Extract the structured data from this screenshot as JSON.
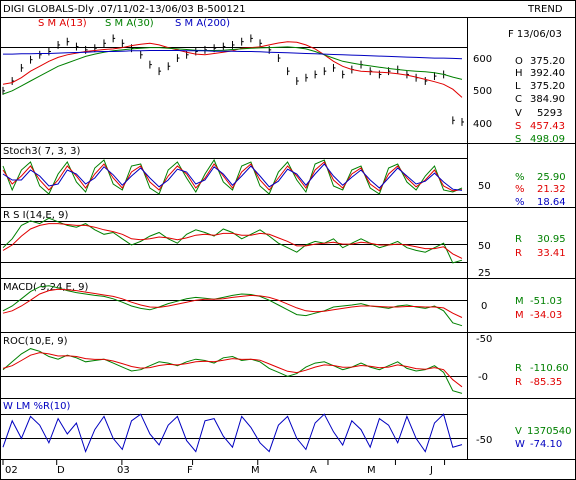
{
  "header": {
    "title": "DIGI GLOBALS-Dly .07/11/02-13/06/03  B-500121",
    "trend": "TREND"
  },
  "colors": {
    "black": "#000000",
    "red": "#e00000",
    "green": "#008000",
    "blue": "#0000c0"
  },
  "chart_data": [
    {
      "type": "line",
      "panel": "price",
      "legend": [
        {
          "label": "S M A(13)",
          "color": "#e00000"
        },
        {
          "label": "S M A(30)",
          "color": "#008000"
        },
        {
          "label": "S M A(200)",
          "color": "#0000c0"
        }
      ],
      "ylim": [
        330,
        690
      ],
      "yticks": [
        "600",
        "500",
        "400"
      ],
      "series": [
        {
          "name": "S M A(13)",
          "values": [
            500,
            505,
            520,
            540,
            555,
            570,
            582,
            590,
            595,
            600,
            603,
            606,
            608,
            612,
            618,
            622,
            625,
            620,
            612,
            605,
            598,
            592,
            590,
            594,
            598,
            602,
            610,
            612,
            614,
            620,
            626,
            630,
            628,
            620,
            608,
            590,
            570,
            555,
            545,
            540,
            538,
            537,
            535,
            532,
            528,
            522,
            515,
            508,
            500,
            485,
            460
          ]
        },
        {
          "name": "S M A(30)",
          "values": [
            470,
            480,
            495,
            510,
            525,
            540,
            555,
            565,
            575,
            585,
            592,
            598,
            602,
            605,
            608,
            610,
            612,
            612,
            610,
            608,
            606,
            604,
            603,
            603,
            604,
            606,
            608,
            610,
            611,
            612,
            613,
            614,
            612,
            608,
            600,
            590,
            580,
            570,
            565,
            560,
            556,
            552,
            548,
            545,
            542,
            540,
            538,
            535,
            530,
            522,
            515
          ]
        },
        {
          "name": "S M A(200)",
          "values": [
            592,
            592,
            593,
            593,
            594,
            594,
            595,
            596,
            597,
            598,
            599,
            600,
            600,
            601,
            602,
            602,
            603,
            603,
            603,
            603,
            602,
            602,
            602,
            601,
            601,
            601,
            600,
            600,
            599,
            598,
            597,
            596,
            595,
            594,
            593,
            592,
            591,
            590,
            589,
            588,
            587,
            586,
            585,
            584,
            583,
            582,
            581,
            580,
            580,
            579,
            578
          ]
        },
        {
          "name": "Close",
          "values": [
            480,
            510,
            550,
            575,
            590,
            600,
            620,
            630,
            615,
            605,
            610,
            625,
            640,
            625,
            610,
            590,
            560,
            540,
            555,
            580,
            590,
            600,
            605,
            610,
            615,
            620,
            630,
            640,
            625,
            605,
            580,
            540,
            510,
            520,
            530,
            540,
            550,
            530,
            545,
            560,
            540,
            530,
            540,
            545,
            530,
            520,
            510,
            525,
            530,
            390,
            385
          ]
        }
      ],
      "readout": {
        "date": "F 13/06/03",
        "rows": [
          {
            "k": "O",
            "v": "375.20",
            "color": "#000000"
          },
          {
            "k": "H",
            "v": "392.40",
            "color": "#000000"
          },
          {
            "k": "L",
            "v": "375.20",
            "color": "#000000"
          },
          {
            "k": "C",
            "v": "384.90",
            "color": "#000000"
          },
          {
            "k": "V",
            "v": "5293",
            "color": "#000000"
          },
          {
            "k": "S",
            "v": "457.43",
            "color": "#e00000"
          },
          {
            "k": "S",
            "v": "498.09",
            "color": "#008000"
          }
        ]
      }
    },
    {
      "type": "line",
      "panel": "stochastic",
      "title": "Stoch3( 7, 3, 3)",
      "yticks": [
        "50"
      ],
      "series": [
        {
          "name": "%K",
          "values": [
            80,
            20,
            70,
            90,
            30,
            10,
            60,
            90,
            40,
            15,
            75,
            95,
            35,
            20,
            80,
            85,
            25,
            10,
            70,
            90,
            50,
            15,
            60,
            95,
            40,
            20,
            80,
            90,
            30,
            10,
            65,
            90,
            45,
            15,
            85,
            95,
            30,
            20,
            70,
            80,
            25,
            10,
            75,
            85,
            40,
            20,
            55,
            80,
            20,
            15,
            25
          ]
        },
        {
          "name": "%D",
          "values": [
            70,
            35,
            55,
            80,
            45,
            20,
            45,
            80,
            55,
            25,
            60,
            85,
            50,
            25,
            65,
            80,
            40,
            20,
            55,
            80,
            60,
            25,
            50,
            85,
            55,
            25,
            65,
            85,
            45,
            20,
            50,
            80,
            55,
            25,
            70,
            90,
            45,
            25,
            60,
            75,
            35,
            18,
            60,
            80,
            50,
            28,
            45,
            70,
            30,
            18,
            21
          ]
        },
        {
          "name": "%D slow",
          "values": [
            60,
            45,
            45,
            70,
            55,
            30,
            35,
            70,
            60,
            35,
            50,
            78,
            58,
            32,
            55,
            75,
            50,
            28,
            45,
            72,
            65,
            35,
            45,
            78,
            60,
            32,
            55,
            80,
            55,
            28,
            42,
            72,
            60,
            32,
            60,
            85,
            55,
            32,
            52,
            70,
            45,
            25,
            50,
            75,
            55,
            35,
            42,
            62,
            40,
            22,
            19
          ]
        }
      ],
      "readout": [
        {
          "k": "%",
          "v": "25.90",
          "color": "#008000"
        },
        {
          "k": "%",
          "v": "21.32",
          "color": "#e00000"
        },
        {
          "k": "%",
          "v": "18.64",
          "color": "#0000c0"
        }
      ]
    },
    {
      "type": "line",
      "panel": "rsi",
      "title": "R S I(14,E, 9)",
      "yticks": [
        "50",
        "25"
      ],
      "series": [
        {
          "name": "RSI",
          "values": [
            45,
            55,
            70,
            75,
            72,
            78,
            74,
            70,
            68,
            72,
            65,
            60,
            62,
            55,
            48,
            52,
            58,
            62,
            55,
            50,
            60,
            65,
            62,
            58,
            66,
            62,
            55,
            60,
            65,
            58,
            50,
            45,
            40,
            48,
            52,
            50,
            55,
            45,
            50,
            55,
            50,
            45,
            48,
            52,
            45,
            42,
            40,
            45,
            50,
            28,
            31
          ]
        },
        {
          "name": "Signal",
          "values": [
            42,
            48,
            58,
            66,
            70,
            72,
            72,
            71,
            70,
            70,
            68,
            65,
            63,
            60,
            55,
            54,
            55,
            57,
            56,
            54,
            56,
            59,
            60,
            59,
            61,
            61,
            59,
            59,
            61,
            60,
            56,
            52,
            47,
            47,
            49,
            50,
            51,
            49,
            49,
            51,
            50,
            48,
            48,
            49,
            48,
            46,
            44,
            44,
            46,
            38,
            33
          ]
        }
      ],
      "readout": [
        {
          "k": "R",
          "v": "30.95",
          "color": "#008000"
        },
        {
          "k": "R",
          "v": "33.41",
          "color": "#e00000"
        }
      ]
    },
    {
      "type": "line",
      "panel": "macd",
      "title": "MACD( 9,24,E, 9)",
      "yticks": [
        "0",
        "-50"
      ],
      "series": [
        {
          "name": "MACD",
          "values": [
            -20,
            -10,
            5,
            20,
            30,
            32,
            28,
            22,
            18,
            15,
            12,
            10,
            5,
            -2,
            -10,
            -15,
            -18,
            -12,
            -5,
            0,
            5,
            8,
            6,
            4,
            8,
            12,
            15,
            14,
            10,
            2,
            -8,
            -18,
            -28,
            -30,
            -25,
            -20,
            -12,
            -10,
            -8,
            -5,
            -10,
            -12,
            -15,
            -10,
            -8,
            -12,
            -15,
            -10,
            -20,
            -45,
            -51
          ]
        },
        {
          "name": "Signal",
          "values": [
            -25,
            -20,
            -10,
            2,
            15,
            22,
            25,
            24,
            22,
            19,
            16,
            13,
            10,
            5,
            -2,
            -8,
            -12,
            -13,
            -10,
            -6,
            -2,
            2,
            4,
            4,
            5,
            8,
            10,
            12,
            11,
            8,
            2,
            -6,
            -14,
            -20,
            -22,
            -21,
            -18,
            -15,
            -12,
            -10,
            -10,
            -11,
            -12,
            -12,
            -11,
            -11,
            -12,
            -12,
            -14,
            -25,
            -34
          ]
        }
      ],
      "readout": [
        {
          "k": "M",
          "v": "-51.03",
          "color": "#008000"
        },
        {
          "k": "M",
          "v": "-34.03",
          "color": "#e00000"
        }
      ]
    },
    {
      "type": "line",
      "panel": "roc",
      "title": "ROC(10,E, 9)",
      "yticks": [
        "-0"
      ],
      "series": [
        {
          "name": "ROC",
          "values": [
            -20,
            10,
            40,
            60,
            50,
            30,
            20,
            35,
            25,
            10,
            15,
            20,
            5,
            -10,
            -25,
            -20,
            -5,
            10,
            5,
            -5,
            10,
            20,
            15,
            5,
            25,
            30,
            15,
            20,
            10,
            -15,
            -30,
            -45,
            -35,
            -10,
            5,
            10,
            -5,
            -20,
            -10,
            5,
            -10,
            -20,
            -5,
            10,
            -15,
            -25,
            -20,
            -5,
            -30,
            -100,
            -110
          ]
        },
        {
          "name": "Signal",
          "values": [
            -15,
            -5,
            15,
            35,
            45,
            40,
            32,
            33,
            30,
            22,
            19,
            19,
            13,
            3,
            -8,
            -14,
            -12,
            -4,
            0,
            -2,
            3,
            10,
            12,
            10,
            16,
            22,
            19,
            20,
            16,
            2,
            -12,
            -26,
            -31,
            -22,
            -10,
            -2,
            -4,
            -11,
            -10,
            -4,
            -7,
            -13,
            -10,
            -2,
            -8,
            -16,
            -18,
            -12,
            -20,
            -58,
            -85
          ]
        }
      ],
      "readout": [
        {
          "k": "R",
          "v": "-110.60",
          "color": "#008000"
        },
        {
          "k": "R",
          "v": "-85.35",
          "color": "#e00000"
        }
      ]
    },
    {
      "type": "line",
      "panel": "williams",
      "title": "W LM %R(10)",
      "yticks": [
        "-50"
      ],
      "series": [
        {
          "name": "%R",
          "values": [
            -80,
            -20,
            -60,
            -10,
            -30,
            -70,
            -15,
            -50,
            -25,
            -90,
            -40,
            -10,
            -60,
            -85,
            -20,
            -5,
            -50,
            -75,
            -30,
            -10,
            -65,
            -90,
            -20,
            -15,
            -55,
            -80,
            -10,
            -35,
            -70,
            -90,
            -30,
            -10,
            -60,
            -85,
            -25,
            -5,
            -45,
            -75,
            -20,
            -40,
            -80,
            -15,
            -30,
            -70,
            -10,
            -60,
            -90,
            -25,
            -5,
            -80,
            -74
          ]
        }
      ],
      "readout": [
        {
          "k": "V",
          "v": "1370540",
          "color": "#008000"
        },
        {
          "k": "W",
          "v": "-74.10",
          "color": "#0000c0"
        }
      ]
    }
  ],
  "xaxis": {
    "labels": [
      "02",
      "D",
      "03",
      "F",
      "M",
      "A",
      "M",
      "J"
    ],
    "positions": [
      0,
      0.117,
      0.259,
      0.413,
      0.555,
      0.708,
      0.855,
      0.962
    ]
  }
}
